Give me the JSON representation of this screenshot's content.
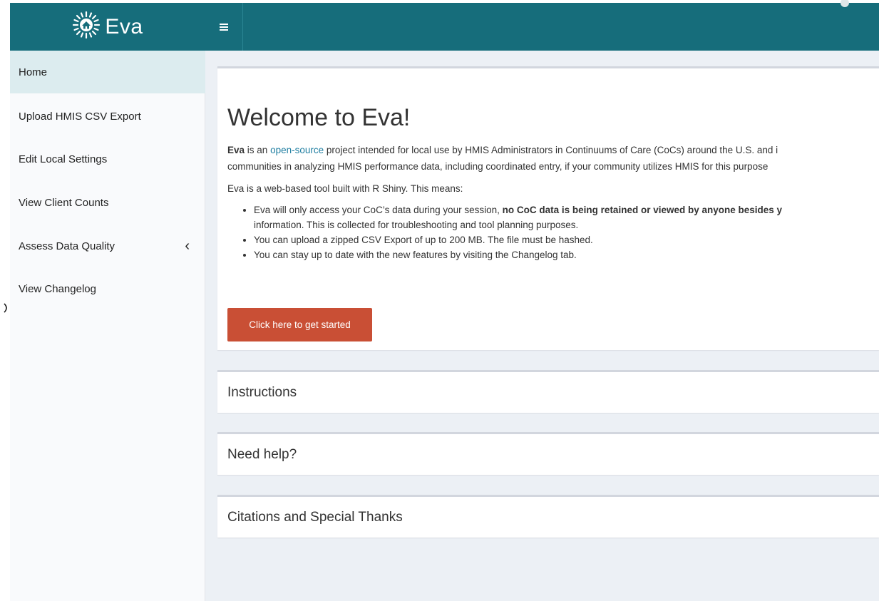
{
  "header": {
    "brand": "Eva",
    "logo_icon": "sun-house-icon",
    "toggle_icon": "hamburger-icon"
  },
  "sidebar": {
    "items": [
      {
        "label": "Home",
        "active": true
      },
      {
        "label": "Upload HMIS CSV Export"
      },
      {
        "label": "Edit Local Settings"
      },
      {
        "label": "View Client Counts"
      },
      {
        "label": "Assess Data Quality",
        "chevron": "‹"
      },
      {
        "label": "View Changelog"
      }
    ]
  },
  "welcome": {
    "title": "Welcome to Eva!",
    "intro_bold": "Eva",
    "intro_pre": " is an ",
    "intro_link": "open-source",
    "intro_post": " project intended for local use by HMIS Administrators in Continuums of Care (CoCs) around the U.S. and i",
    "intro_line2": "communities in analyzing HMIS performance data, including coordinated entry, if your community utilizes HMIS for this purpose",
    "tool_line": "Eva is a web-based tool built with R Shiny. This means:",
    "bullet1_pre": "Eva will only access your CoC’s data during your session, ",
    "bullet1_bold": "no CoC data is being retained or viewed by anyone besides y",
    "bullet1_line2": "information. This is collected for troubleshooting and tool planning purposes.",
    "bullet2": "You can upload a zipped CSV Export of up to 200 MB. The file must be hashed.",
    "bullet3": "You can stay up to date with the new features by visiting the Changelog tab.",
    "button": "Click here to get started"
  },
  "panels": {
    "instructions": "Instructions",
    "need_help": "Need help?",
    "citations": "Citations and Special Thanks"
  },
  "colors": {
    "header": "#166d7b",
    "active_item": "#dcecef",
    "button": "#c94f35",
    "link": "#1f7ea1",
    "content_bg": "#ecf0f5"
  }
}
